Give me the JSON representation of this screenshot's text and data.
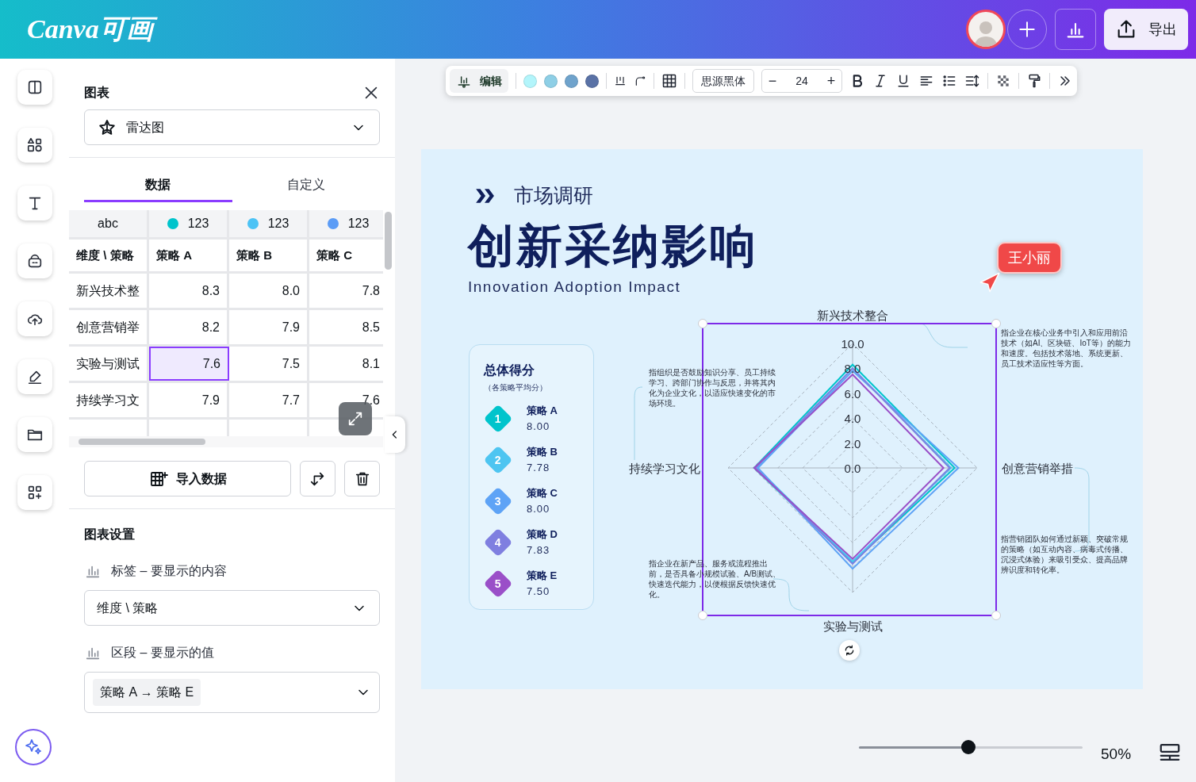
{
  "topbar": {
    "logo": "Canva可画",
    "export_button": "导出"
  },
  "panel": {
    "title": "图表",
    "chart_type": "雷达图",
    "tabs": [
      {
        "label": "数据",
        "selected": true
      },
      {
        "label": "自定义",
        "selected": false
      }
    ],
    "table": {
      "type_row": [
        {
          "label": "abc"
        },
        {
          "label": "123",
          "color": "#00c4cc"
        },
        {
          "label": "123",
          "color": "#4cc3f5"
        },
        {
          "label": "123",
          "color": "#5b9cf6"
        }
      ],
      "header": [
        "维度 \\ 策略",
        "策略 A",
        "策略 B",
        "策略 C"
      ],
      "rows": [
        {
          "cells": [
            {
              "text": "新兴技术整",
              "selected": false
            },
            {
              "text": "8.3",
              "selected": false
            },
            {
              "text": "8.0",
              "selected": false
            },
            {
              "text": "7.8",
              "selected": false
            }
          ]
        },
        {
          "cells": [
            {
              "text": "创意营销举",
              "selected": false
            },
            {
              "text": "8.2",
              "selected": false
            },
            {
              "text": "7.9",
              "selected": false
            },
            {
              "text": "8.5",
              "selected": false
            }
          ]
        },
        {
          "cells": [
            {
              "text": "实验与测试",
              "selected": false
            },
            {
              "text": "7.6",
              "selected": true
            },
            {
              "text": "7.5",
              "selected": false
            },
            {
              "text": "8.1",
              "selected": false
            }
          ]
        },
        {
          "cells": [
            {
              "text": "持续学习文",
              "selected": false
            },
            {
              "text": "7.9",
              "selected": false
            },
            {
              "text": "7.7",
              "selected": false
            },
            {
              "text": "7.6",
              "selected": false
            }
          ]
        }
      ]
    },
    "import_button": "导入数据",
    "settings": {
      "title": "图表设置",
      "label_field": {
        "label": "标签 – 要显示的内容",
        "value": "维度 \\ 策略"
      },
      "segment_field": {
        "label": "区段 – 要显示的值",
        "chip": "策略 A → 策略 E"
      }
    }
  },
  "toolbar": {
    "edit_button": "编辑",
    "swatches": [
      {
        "color": "#b3f5fb"
      },
      {
        "color": "#8ecfe6"
      },
      {
        "color": "#6fa3cc"
      },
      {
        "color": "#5a72a6"
      }
    ],
    "font": "思源黑体",
    "font_size": "24",
    "decrease": "−",
    "increase": "+"
  },
  "page": {
    "kicker": "市场调研",
    "title": "创新采纳影响",
    "subtitle": "Innovation Adoption Impact",
    "comment": "王小丽",
    "scores": {
      "title": "总体得分",
      "note": "（各策略平均分）",
      "items": [
        {
          "number": "1",
          "name": "策略 A",
          "score": "8.00",
          "color": "#00c4cc"
        },
        {
          "number": "2",
          "name": "策略 B",
          "score": "7.78",
          "color": "#4ec5f1"
        },
        {
          "number": "3",
          "name": "策略 C",
          "score": "8.00",
          "color": "#5ea3f6"
        },
        {
          "number": "4",
          "name": "策略 D",
          "score": "7.83",
          "color": "#7f7fe0"
        },
        {
          "number": "5",
          "name": "策略 E",
          "score": "7.50",
          "color": "#9a4fc8"
        }
      ]
    },
    "chart_data": {
      "type": "radar",
      "categories": [
        "新兴技术整合",
        "创意营销举措",
        "实验与测试",
        "持续学习文化"
      ],
      "series": [
        {
          "color": "#00c4cc",
          "values": [
            8.3,
            8.2,
            7.6,
            7.9
          ]
        },
        {
          "color": "#4ec5f1",
          "values": [
            8.0,
            7.9,
            7.5,
            7.7
          ]
        },
        {
          "color": "#5ea3f6",
          "values": [
            7.8,
            8.5,
            8.1,
            7.6
          ]
        },
        {
          "color": "#7f7fe0",
          "values": [
            8.0,
            7.8,
            7.7,
            7.8
          ]
        },
        {
          "color": "#9a4fc8",
          "values": [
            7.5,
            7.3,
            7.3,
            7.9
          ]
        }
      ],
      "ylim": [
        0,
        10
      ],
      "yticks": [
        {
          "value": 0,
          "label": "0.0"
        },
        {
          "value": 2,
          "label": "2.0"
        },
        {
          "value": 4,
          "label": "4.0"
        },
        {
          "value": 6,
          "label": "6.0"
        },
        {
          "value": 8,
          "label": "8.0"
        },
        {
          "value": 10,
          "label": "10.0"
        }
      ]
    },
    "annotations": [
      "指企业在核心业务中引入和应用前沿技术（如AI、区块链、IoT等）的能力和速度。包括技术落地、系统更新、员工技术适应性等方面。",
      "指组织是否鼓励知识分享、员工持续学习、跨部门协作与反思，并将其内化为企业文化，以适应快速变化的市场环境。",
      "指营销团队如何通过新颖、突破常规的策略（如互动内容、病毒式传播、沉浸式体验）来吸引受众、提高品牌辨识度和转化率。",
      "指企业在新产品、服务或流程推出前，是否具备小规模试验、A/B测试、快速迭代能力，以便根据反馈快速优化。"
    ]
  },
  "zoom": {
    "level": 0.49,
    "reading": "50%"
  }
}
